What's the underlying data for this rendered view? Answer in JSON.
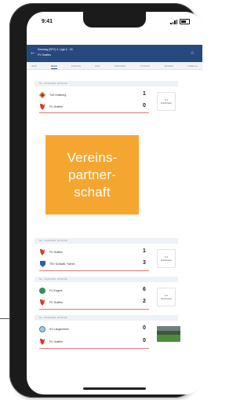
{
  "status_bar": {
    "time": "9:41"
  },
  "header": {
    "title": "Sonntag (SFV) 4. Liga 4 - 24",
    "subtitle": "FV Graffen",
    "back_icon": "arrow-left-icon",
    "star_icon": "star-icon"
  },
  "tabs": [
    "2020",
    "ALLE",
    "KARTEN",
    "2021",
    "FREUNDE",
    "TICKETS",
    "MEDIEN",
    "TABELLE"
  ],
  "matches": [
    {
      "date": "So., 22.08.2021, 15:00 Uhr",
      "home": "TuS Holsberg",
      "away": "FV Graffen",
      "home_score": "1",
      "away_score": "0",
      "badge": "3:1\nZuschauer"
    },
    {
      "date": "So., 12.09.2021, 15:30 Uhr",
      "home": "FV Graffen",
      "away": "TSV Schwäb. Hamm",
      "home_score": "1",
      "away_score": "3",
      "badge": "3:1\nZuschauer"
    },
    {
      "date": "So., 19.09.2021, 15:00 Uhr",
      "home": "FV Engers",
      "away": "FV Graffen",
      "home_score": "6",
      "away_score": "2",
      "badge": "3:1\nZuschauer"
    },
    {
      "date": "So., 26.09.2021, 15:00 Uhr",
      "home": "SV Langenheim",
      "away": "FV Graffen",
      "home_score": "0",
      "away_score": "0"
    }
  ],
  "overlay": {
    "lines": [
      "Vereins-",
      "partner-",
      "schaft"
    ],
    "color": "#f5a631"
  },
  "colors": {
    "appbar": "#274a7e",
    "phone": "#1b1b1b"
  }
}
